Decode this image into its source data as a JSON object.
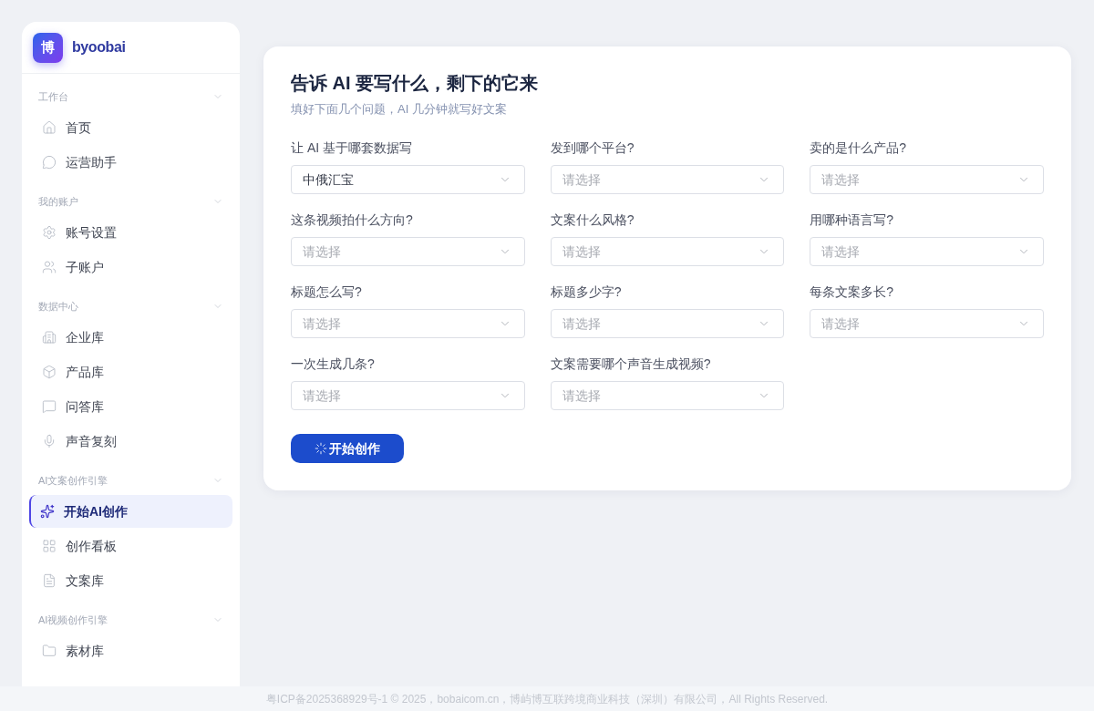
{
  "sidebar": {
    "logo": {
      "glyph": "博",
      "name": "byoobai"
    },
    "sections": [
      {
        "title": "工作台",
        "expanded": true,
        "items": [
          {
            "label": "首页",
            "selected": false
          },
          {
            "label": "运营助手",
            "selected": false
          }
        ]
      },
      {
        "title": "我的账户",
        "expanded": true,
        "items": [
          {
            "label": "账号设置",
            "selected": false
          },
          {
            "label": "子账户",
            "selected": false
          }
        ]
      },
      {
        "title": "数据中心",
        "expanded": true,
        "items": [
          {
            "label": "企业库",
            "selected": false
          },
          {
            "label": "产品库",
            "selected": false
          },
          {
            "label": "问答库",
            "selected": false
          },
          {
            "label": "声音复刻",
            "selected": false
          }
        ]
      },
      {
        "title": "AI文案创作引擎",
        "expanded": true,
        "items": [
          {
            "label": "开始AI创作",
            "selected": true
          },
          {
            "label": "创作看板",
            "selected": false
          },
          {
            "label": "文案库",
            "selected": false
          }
        ]
      },
      {
        "title": "AI视频创作引擎",
        "expanded": true,
        "items": [
          {
            "label": "素材库",
            "selected": false
          }
        ]
      }
    ]
  },
  "form": {
    "title": "告诉 AI 要写什么，剩下的它来",
    "subtitle": "填好下面几个问题，AI 几分钟就写好文案",
    "fields": [
      {
        "label": "让 AI 基于哪套数据写",
        "value": "中俄汇宝"
      },
      {
        "label": "发到哪个平台?",
        "placeholder": "请选择"
      },
      {
        "label": "卖的是什么产品?",
        "placeholder": "请选择"
      },
      {
        "label": "这条视频拍什么方向?",
        "placeholder": "请选择"
      },
      {
        "label": "文案什么风格?",
        "placeholder": "请选择"
      },
      {
        "label": "用哪种语言写?",
        "placeholder": "请选择"
      },
      {
        "label": "标题怎么写?",
        "placeholder": "请选择"
      },
      {
        "label": "标题多少字?",
        "placeholder": "请选择"
      },
      {
        "label": "每条文案多长?",
        "placeholder": "请选择"
      },
      {
        "label": "一次生成几条?",
        "placeholder": "请选择"
      },
      {
        "label": "文案需要哪个声音生成视频?",
        "placeholder": "请选择"
      }
    ],
    "submit_button": "开始创作"
  },
  "footer": "粤ICP备2025368929号-1 © 2025，bobaicom.cn，博屿博互联跨境商业科技（深圳）有限公司，All Rights Reserved."
}
